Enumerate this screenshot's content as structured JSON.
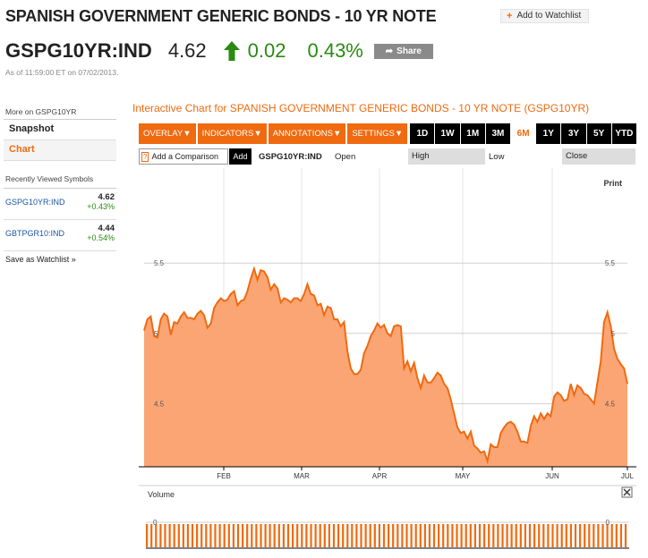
{
  "header": {
    "title": "SPANISH GOVERNMENT GENERIC BONDS - 10 YR NOTE",
    "watchlist_label": "Add to Watchlist",
    "watchlist_icon": "plus-icon"
  },
  "quote": {
    "symbol": "GSPG10YR:IND",
    "price": "4.62",
    "direction_icon": "up-arrow-icon",
    "change": "0.02",
    "pct_change": "0.43%",
    "share_label": "Share",
    "as_of": "As of 11:59:00 ET on 07/02/2013.",
    "up_color": "#2a8a12"
  },
  "sidebar": {
    "heading": "More on GSPG10YR",
    "items": [
      {
        "label": "Snapshot"
      },
      {
        "label": "Chart"
      }
    ],
    "recent_heading": "Recently Viewed Symbols",
    "recent": [
      {
        "symbol": "GSPG10YR:IND",
        "value": "4.62",
        "change": "+0.43%"
      },
      {
        "symbol": "GBTPGR10:IND",
        "value": "4.44",
        "change": "+0.54%"
      }
    ],
    "save_label": "Save as Watchlist",
    "save_icon": "double-chevron-right-icon"
  },
  "chart_panel": {
    "title": "Interactive Chart for SPANISH GOVERNMENT GENERIC BONDS - 10 YR NOTE (GSPG10YR)",
    "menus": [
      "OVERLAY",
      "INDICATORS",
      "ANNOTATIONS",
      "SETTINGS"
    ],
    "ranges": [
      "1D",
      "1W",
      "1M",
      "3M",
      "6M",
      "1Y",
      "3Y",
      "5Y",
      "YTD"
    ],
    "active_range": "6M",
    "compare_placeholder": "Add a Comparison",
    "compare_help": "?",
    "add_label": "Add",
    "symbol": "GSPG10YR:IND",
    "open_label": "Open",
    "high_label": "High",
    "low_label": "Low",
    "close_label": "Close",
    "print_label": "Print",
    "volume_label": "Volume",
    "close_icon": "close-icon",
    "accent": "#f06a10"
  },
  "chart_data": {
    "type": "area",
    "xlabel": "",
    "ylabel": "",
    "x_ticks": [
      "FEB",
      "MAR",
      "APR",
      "MAY",
      "JUN",
      "JUL"
    ],
    "y_ticks": [
      4.5,
      5,
      5.5
    ],
    "ylim": [
      4.05,
      6.1
    ],
    "grid": true,
    "series": [
      {
        "values": [
          5.02,
          5.1,
          5.12,
          4.98,
          4.97,
          5.1,
          5.14,
          5.12,
          4.99,
          5.08,
          5.07,
          5.12,
          5.15,
          5.11,
          5.11,
          5.1,
          5.14,
          5.16,
          5.13,
          5.04,
          5.07,
          5.18,
          5.22,
          5.25,
          5.23,
          5.24,
          5.28,
          5.3,
          5.2,
          5.23,
          5.24,
          5.3,
          5.39,
          5.46,
          5.38,
          5.45,
          5.44,
          5.4,
          5.31,
          5.35,
          5.32,
          5.22,
          5.25,
          5.24,
          5.22,
          5.25,
          5.25,
          5.23,
          5.28,
          5.35,
          5.28,
          5.27,
          5.2,
          5.21,
          5.13,
          5.19,
          5.18,
          5.1,
          5.1,
          5.05,
          5.08,
          4.87,
          4.75,
          4.71,
          4.71,
          4.74,
          4.86,
          4.91,
          4.98,
          5.02,
          5.07,
          5.04,
          5.06,
          5.0,
          4.98,
          5.05,
          5.06,
          5.05,
          4.75,
          4.8,
          4.73,
          4.79,
          4.68,
          4.61,
          4.7,
          4.65,
          4.65,
          4.68,
          4.72,
          4.7,
          4.64,
          4.61,
          4.53,
          4.43,
          4.33,
          4.29,
          4.3,
          4.25,
          4.3,
          4.2,
          4.18,
          4.15,
          4.16,
          4.09,
          4.21,
          4.19,
          4.19,
          4.29,
          4.33,
          4.36,
          4.37,
          4.35,
          4.3,
          4.23,
          4.23,
          4.22,
          4.34,
          4.41,
          4.37,
          4.43,
          4.39,
          4.43,
          4.41,
          4.55,
          4.58,
          4.56,
          4.52,
          4.53,
          4.64,
          4.56,
          4.63,
          4.61,
          4.57,
          4.56,
          4.53,
          4.5,
          4.65,
          4.8,
          5.08,
          5.15,
          5.05,
          4.89,
          4.82,
          4.78,
          4.75,
          4.64
        ]
      }
    ],
    "volume": {
      "ticks": [
        0
      ],
      "bar_count": 106
    }
  }
}
